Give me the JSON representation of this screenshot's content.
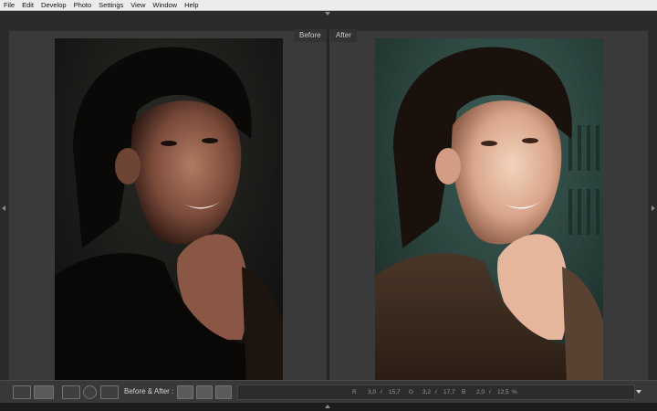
{
  "menu": [
    "File",
    "Edit",
    "Develop",
    "Photo",
    "Settings",
    "View",
    "Window",
    "Help"
  ],
  "view": {
    "before_label": "Before",
    "after_label": "After"
  },
  "toolbar": {
    "before_after_label": "Before & After :",
    "readout": {
      "r_label": "R",
      "r_before": "3,0",
      "r_sep": "/",
      "r_after": "15,7",
      "g_label": "G",
      "g_before": "3,2",
      "g_sep": "/",
      "g_after": "17,7",
      "b_label": "B",
      "b_before": "2,0",
      "b_sep": "/",
      "b_after": "12,5",
      "unit": "%"
    }
  },
  "icons": {
    "loupe_view": "single-frame-icon",
    "before_after_view": "yy-compare-icon",
    "crop": "crop-overlay-icon",
    "spot": "spot-removal-icon",
    "redeye": "redeye-icon",
    "copy_left_to_right": "copy-settings-icon",
    "copy_right_to_left": "copy-settings-icon",
    "swap": "swap-icon"
  }
}
